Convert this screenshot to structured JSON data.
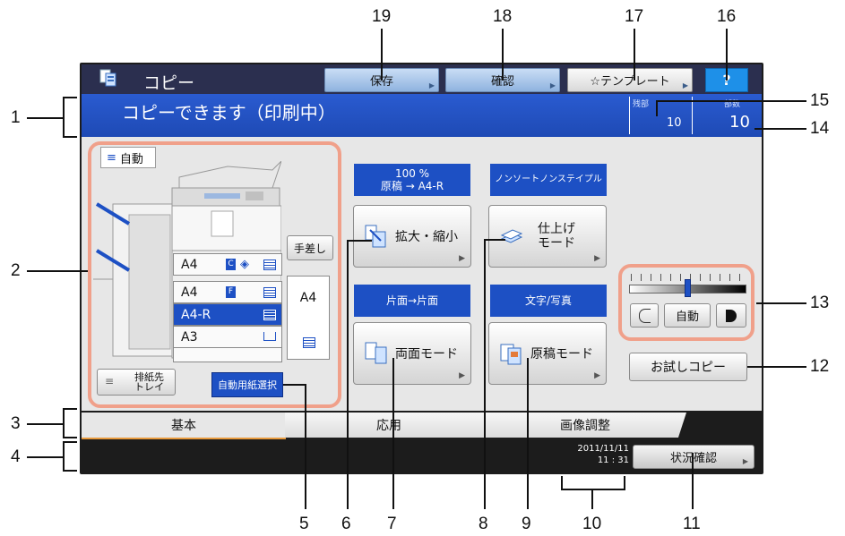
{
  "app": {
    "title": "コピー",
    "help_label": "?"
  },
  "toolbar": {
    "save_label": "保存",
    "confirm_label": "確認",
    "template_label": "☆テンプレート"
  },
  "status": {
    "message": "コピーできます（印刷中）",
    "remaining_label": "残部",
    "remaining_value": "10",
    "copies_label": "部数",
    "copies_value": "10"
  },
  "paper": {
    "auto_label": "自動",
    "trays": [
      {
        "size": "A4",
        "badge": "C",
        "selected": false
      },
      {
        "size": "A4",
        "badge": "F",
        "selected": false
      },
      {
        "size": "A4-R",
        "badge": "",
        "selected": true
      },
      {
        "size": "A3",
        "badge": "",
        "selected": false
      }
    ],
    "bypass_label": "手差し",
    "bypass_size": "A4",
    "exit_tray_label_1": "排紙先",
    "exit_tray_label_2": "トレイ",
    "auto_paper_label": "自動用紙選択"
  },
  "functions": {
    "zoom": {
      "head1": "100 %",
      "head2": "原稿 → A4-R",
      "label": "拡大・縮小"
    },
    "finishing": {
      "head1": "ノンソートノンステイプル",
      "label1": "仕上げ",
      "label2": "モード"
    },
    "duplex": {
      "head1": "片面→片面",
      "label": "両面モード"
    },
    "original": {
      "head1": "文字/写真",
      "label": "原稿モード"
    }
  },
  "density": {
    "auto_label": "自動",
    "level": 0.5
  },
  "trial_copy_label": "お試しコピー",
  "tabs": [
    {
      "label": "基本",
      "active": true
    },
    {
      "label": "応用",
      "active": false
    },
    {
      "label": "画像調整",
      "active": false
    }
  ],
  "footer": {
    "date": "2011/11/11",
    "time": "11 : 31",
    "status_label": "状況確認"
  },
  "callouts": [
    "1",
    "2",
    "3",
    "4",
    "5",
    "6",
    "7",
    "8",
    "9",
    "10",
    "11",
    "12",
    "13",
    "14",
    "15",
    "16",
    "17",
    "18",
    "19"
  ],
  "colors": {
    "accent": "#1d50c4",
    "highlight": "#f0a08a",
    "help": "#1e90e8"
  }
}
